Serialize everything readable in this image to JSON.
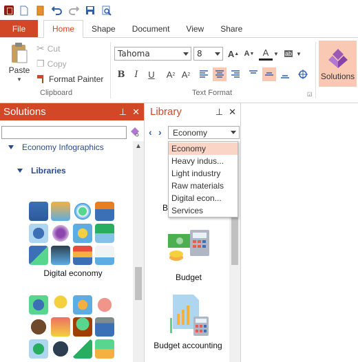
{
  "ribbon": {
    "tabs": {
      "file": "File",
      "home": "Home",
      "shape": "Shape",
      "document": "Document",
      "view": "View",
      "share": "Share"
    },
    "clipboard": {
      "paste": "Paste",
      "cut": "Cut",
      "copy": "Copy",
      "format_painter": "Format Painter",
      "label": "Clipboard"
    },
    "text_format": {
      "font": "Tahoma",
      "size": "8",
      "label": "Text Format"
    },
    "solutions": "Solutions"
  },
  "solutions_panel": {
    "title": "Solutions",
    "search_value": "",
    "tree": {
      "category": "Economy Infographics",
      "libraries": "Libraries"
    },
    "libraries": [
      {
        "name": "Digital economy"
      },
      {
        "name": ""
      }
    ]
  },
  "library_panel": {
    "title": "Library",
    "selected": "Economy",
    "dropdown_options": [
      "Economy",
      "Heavy indus...",
      "Light industry",
      "Raw materials",
      "Digital econ...",
      "Services"
    ],
    "partial_label": "B",
    "items": [
      {
        "name": "Budget"
      },
      {
        "name": "Budget accounting"
      }
    ]
  },
  "colors": {
    "accent": "#d24726",
    "highlight": "#f9c9b4",
    "link": "#2b4a8a"
  }
}
